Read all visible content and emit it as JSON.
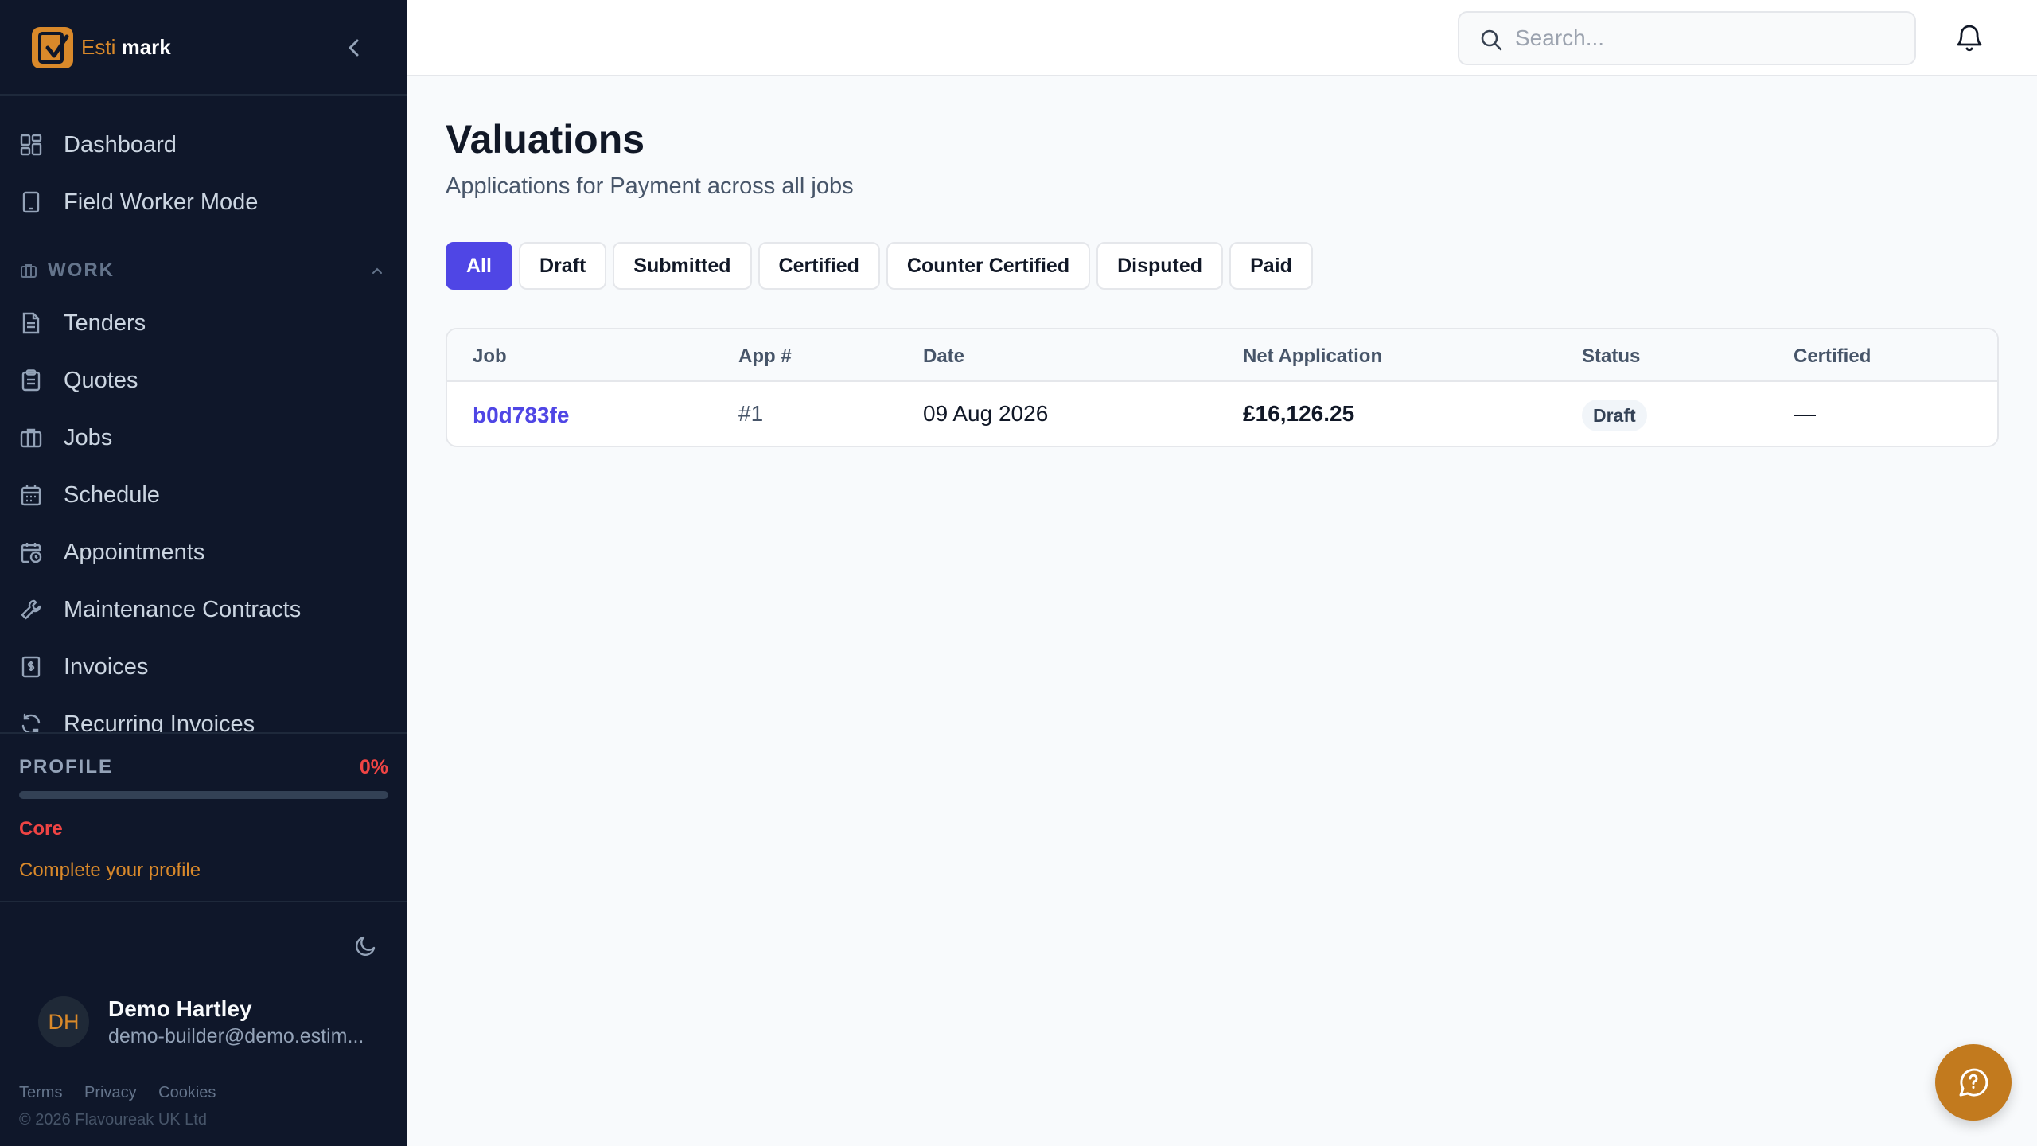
{
  "brand": {
    "name_part1": "Esti",
    "name_part2": "mark",
    "accent_color": "#d9892a"
  },
  "nav": {
    "top": [
      {
        "label": "Dashboard",
        "icon": "dashboard-icon"
      },
      {
        "label": "Field Worker Mode",
        "icon": "tablet-icon"
      }
    ],
    "section_label": "WORK",
    "work": [
      {
        "label": "Tenders",
        "icon": "document-icon"
      },
      {
        "label": "Quotes",
        "icon": "clipboard-icon"
      },
      {
        "label": "Jobs",
        "icon": "briefcase-icon"
      },
      {
        "label": "Schedule",
        "icon": "calendar-icon"
      },
      {
        "label": "Appointments",
        "icon": "calendar-clock-icon"
      },
      {
        "label": "Maintenance Contracts",
        "icon": "wrench-icon"
      },
      {
        "label": "Invoices",
        "icon": "receipt-icon"
      },
      {
        "label": "Recurring Invoices",
        "icon": "refresh-icon"
      }
    ]
  },
  "profile": {
    "title": "PROFILE",
    "percent_label": "0%",
    "percent_value": 0,
    "tier": "Core",
    "cta": "Complete your profile"
  },
  "user": {
    "initials": "DH",
    "name": "Demo Hartley",
    "email": "demo-builder@demo.estim..."
  },
  "footer": {
    "terms": "Terms",
    "privacy": "Privacy",
    "cookies": "Cookies",
    "copyright": "© 2026 Flavoureak UK Ltd"
  },
  "search": {
    "placeholder": "Search..."
  },
  "page": {
    "title": "Valuations",
    "subtitle": "Applications for Payment across all jobs"
  },
  "filters": [
    "All",
    "Draft",
    "Submitted",
    "Certified",
    "Counter Certified",
    "Disputed",
    "Paid"
  ],
  "active_filter": "All",
  "table": {
    "headers": {
      "job": "Job",
      "app": "App #",
      "date": "Date",
      "net": "Net Application",
      "status": "Status",
      "certified": "Certified"
    },
    "rows": [
      {
        "job": "b0d783fe",
        "app": "#1",
        "date": "09 Aug 2026",
        "net": "£16,126.25",
        "status": "Draft",
        "certified": "—"
      }
    ]
  }
}
